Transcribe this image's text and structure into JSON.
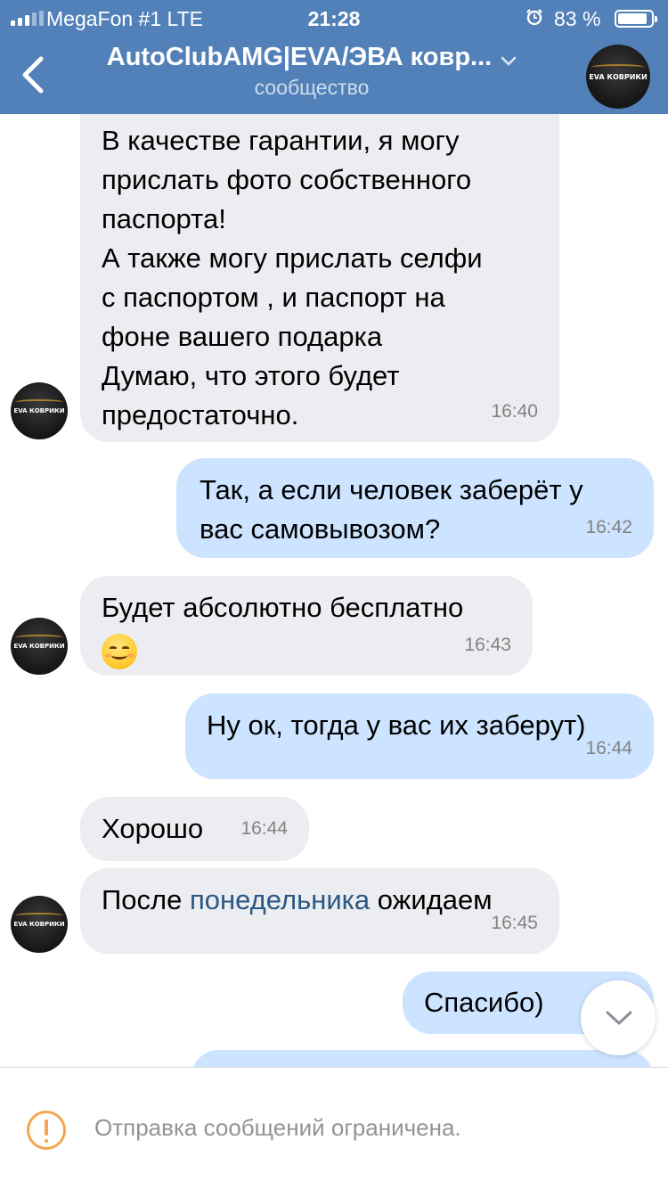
{
  "status_bar": {
    "carrier": "MegaFon #1  LTE",
    "time": "21:28",
    "battery": "83 %"
  },
  "header": {
    "title": "AutoClubAMG|EVA/ЭВА ковр...",
    "subtitle": "сообщество",
    "avatar_label": "EVA КОВРИКИ"
  },
  "messages": [
    {
      "direction": "incoming",
      "lines": [
        "В качестве гарантии, я могу",
        "прислать фото собственного",
        "паспорта!",
        "А также могу прислать селфи",
        "с паспортом , и паспорт на",
        "фоне вашего подарка",
        "Думаю, что этого будет",
        "предостаточно."
      ],
      "time": "16:40"
    },
    {
      "direction": "outgoing",
      "lines": [
        "Так, а если человек заберёт у",
        "вас самовывозом?"
      ],
      "time": "16:42"
    },
    {
      "direction": "incoming",
      "lines": [
        "Будет абсолютно бесплатно"
      ],
      "emoji": "smiling-face",
      "time": "16:43"
    },
    {
      "direction": "outgoing",
      "lines": [
        "Ну ок, тогда у вас их заберут)"
      ],
      "time": "16:44"
    },
    {
      "direction": "incoming",
      "lines": [
        "Хорошо"
      ],
      "time": "16:44"
    },
    {
      "direction": "incoming",
      "before": "После ",
      "link": "понедельника",
      "after": " ожидаем",
      "time": "16:45"
    },
    {
      "direction": "outgoing",
      "lines": [
        "Спасибо)"
      ]
    }
  ],
  "avatar_label": "EVA КОВРИКИ",
  "footer": {
    "notice": "Отправка сообщений ограничена."
  },
  "colors": {
    "header_bg": "#5181b8",
    "incoming_bubble": "#ebedf0",
    "outgoing_bubble": "#cce4ff",
    "link": "#2a5885",
    "warning": "#f5a54f"
  },
  "icons": [
    "back-arrow-icon",
    "chevron-down-icon",
    "alarm-icon",
    "battery-icon",
    "signal-icon",
    "warning-icon",
    "scroll-down-icon"
  ]
}
